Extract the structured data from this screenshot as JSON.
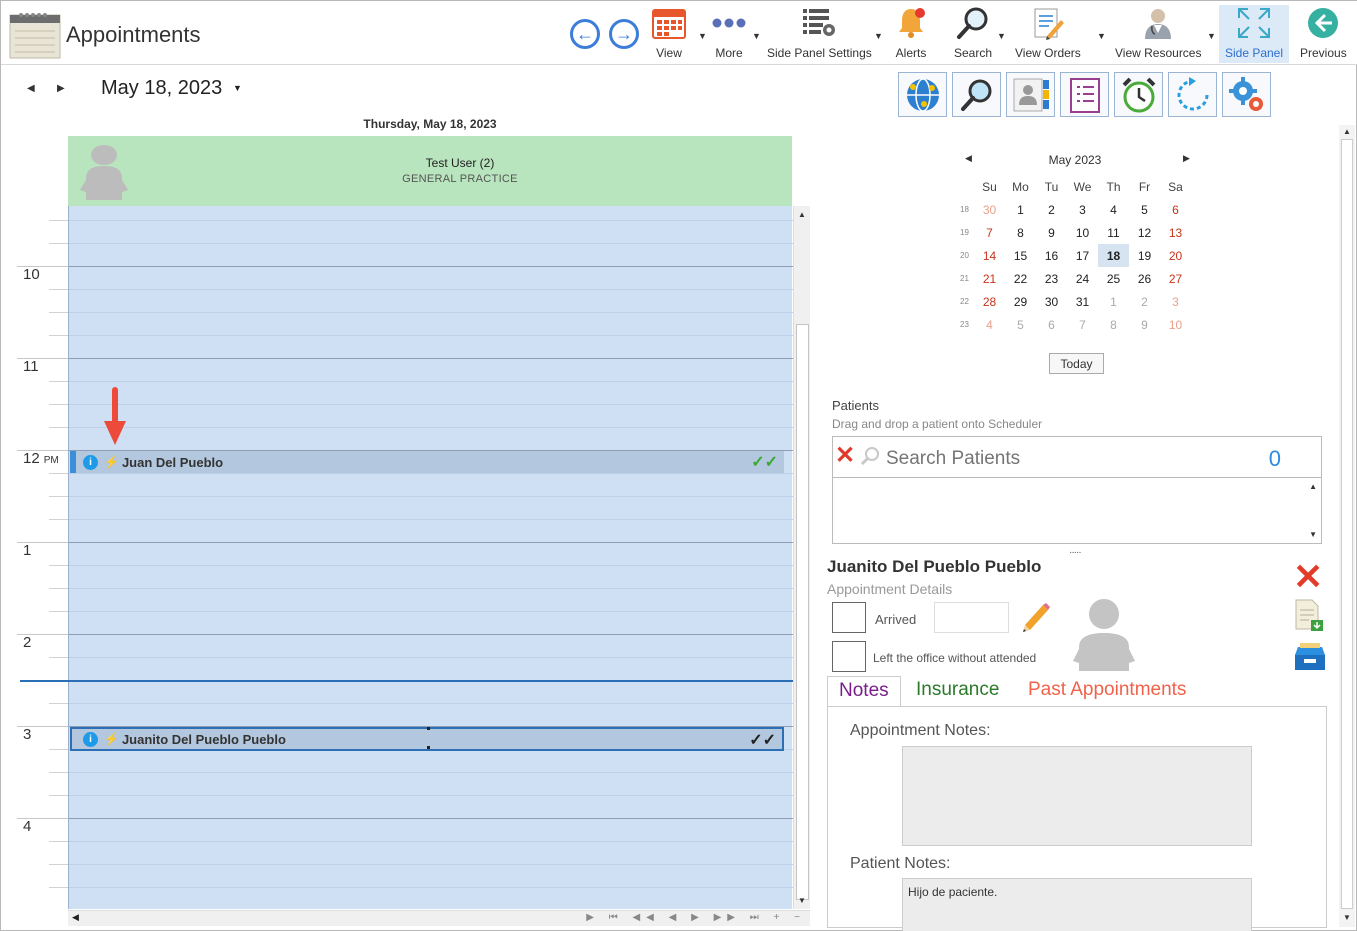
{
  "app": {
    "title": "Appointments"
  },
  "toolbar": {
    "items": [
      {
        "label": "View",
        "icon": "calendar-icon"
      },
      {
        "label": "More",
        "icon": "more-dots-icon"
      },
      {
        "label": "Side Panel Settings",
        "icon": "list-settings-icon"
      },
      {
        "label": "Alerts",
        "icon": "bell-icon"
      },
      {
        "label": "Search",
        "icon": "search-icon"
      },
      {
        "label": "View Orders",
        "icon": "document-edit-icon"
      },
      {
        "label": "View Resources",
        "icon": "doctor-icon"
      },
      {
        "label": "Side Panel",
        "icon": "expand-icon",
        "active": true
      },
      {
        "label": "Previous",
        "icon": "back-circle-icon"
      }
    ]
  },
  "scheduler": {
    "date_label": "May 18, 2023",
    "day_header": "Thursday, May 18, 2023",
    "resource": {
      "name": "Test User (2)",
      "department": "GENERAL PRACTICE"
    },
    "hours": [
      "10",
      "11",
      "12",
      "1",
      "2",
      "3",
      "4"
    ],
    "ampm": "PM",
    "appointments": [
      {
        "name": "Juan Del Pueblo",
        "check_color": "#3aaa35",
        "selected": false
      },
      {
        "name": "Juanito Del Pueblo Pueblo",
        "check_color": "#222222",
        "selected": true
      }
    ]
  },
  "side_panel": {
    "calendar": {
      "title": "May 2023",
      "weekdays": [
        "Su",
        "Mo",
        "Tu",
        "We",
        "Th",
        "Fr",
        "Sa"
      ],
      "weeks": [
        {
          "wk": "18",
          "days": [
            "30",
            "1",
            "2",
            "3",
            "4",
            "5",
            "6"
          ]
        },
        {
          "wk": "19",
          "days": [
            "7",
            "8",
            "9",
            "10",
            "11",
            "12",
            "13"
          ]
        },
        {
          "wk": "20",
          "days": [
            "14",
            "15",
            "16",
            "17",
            "18",
            "19",
            "20"
          ]
        },
        {
          "wk": "21",
          "days": [
            "21",
            "22",
            "23",
            "24",
            "25",
            "26",
            "27"
          ]
        },
        {
          "wk": "22",
          "days": [
            "28",
            "29",
            "30",
            "31",
            "1",
            "2",
            "3"
          ]
        },
        {
          "wk": "23",
          "days": [
            "4",
            "5",
            "6",
            "7",
            "8",
            "9",
            "10"
          ]
        }
      ],
      "selected": "18",
      "today_label": "Today"
    },
    "patients": {
      "title": "Patients",
      "hint": "Drag and drop a patient onto Scheduler",
      "search_placeholder": "Search Patients",
      "count": "0"
    },
    "details": {
      "patient_name": "Juanito Del Pueblo Pueblo",
      "section_title": "Appointment Details",
      "arrived_label": "Arrived",
      "left_label": "Left the office without attended"
    },
    "tabs": [
      "Notes",
      "Insurance",
      "Past Appointments"
    ],
    "notes": {
      "appointment_notes_label": "Appointment Notes:",
      "appointment_notes": "",
      "patient_notes_label": "Patient Notes:",
      "patient_notes": "Hijo de paciente."
    }
  }
}
